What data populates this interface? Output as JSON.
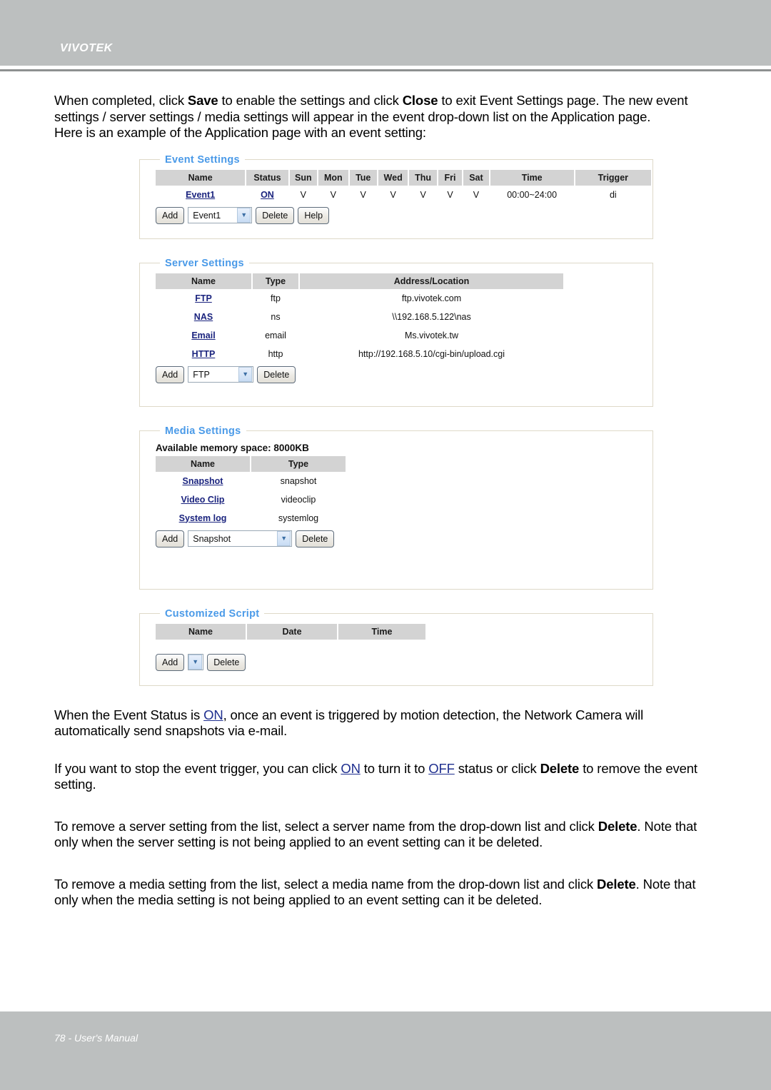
{
  "header": {
    "brand": "VIVOTEK"
  },
  "footer": {
    "text": "78 - User's Manual"
  },
  "intro": {
    "p1_a": "When completed, click ",
    "p1_save": "Save",
    "p1_b": " to enable the settings and click ",
    "p1_close": "Close",
    "p1_c": " to exit Event Settings page. The new event settings / server settings / media settings will appear in the event drop-down list on the Application page.",
    "p2": "Here is an example of the Application page with an event setting:"
  },
  "event_settings": {
    "legend": "Event Settings",
    "columns": [
      "Name",
      "Status",
      "Sun",
      "Mon",
      "Tue",
      "Wed",
      "Thu",
      "Fri",
      "Sat",
      "Time",
      "Trigger"
    ],
    "rows": [
      {
        "name": "Event1",
        "status": "ON",
        "sun": "V",
        "mon": "V",
        "tue": "V",
        "wed": "V",
        "thu": "V",
        "fri": "V",
        "sat": "V",
        "time": "00:00~24:00",
        "trigger": "di"
      }
    ],
    "controls": {
      "add_label": "Add",
      "select_value": "Event1",
      "delete_label": "Delete",
      "help_label": "Help",
      "arrow_icon": "chevron-down-icon"
    }
  },
  "server_settings": {
    "legend": "Server Settings",
    "columns": [
      "Name",
      "Type",
      "Address/Location"
    ],
    "rows": [
      {
        "name": "FTP",
        "type": "ftp",
        "address": "ftp.vivotek.com"
      },
      {
        "name": "NAS",
        "type": "ns",
        "address": "\\\\192.168.5.122\\nas"
      },
      {
        "name": "Email",
        "type": "email",
        "address": "Ms.vivotek.tw"
      },
      {
        "name": "HTTP",
        "type": "http",
        "address": "http://192.168.5.10/cgi-bin/upload.cgi"
      }
    ],
    "controls": {
      "add_label": "Add",
      "select_value": "FTP",
      "delete_label": "Delete",
      "arrow_icon": "chevron-down-icon"
    }
  },
  "media_settings": {
    "legend": "Media Settings",
    "memory_line": "Available memory space: 8000KB",
    "columns": [
      "Name",
      "Type"
    ],
    "rows": [
      {
        "name": "Snapshot",
        "type": "snapshot"
      },
      {
        "name": "Video Clip",
        "type": "videoclip"
      },
      {
        "name": "System log",
        "type": "systemlog"
      }
    ],
    "controls": {
      "add_label": "Add",
      "select_value": "Snapshot",
      "delete_label": "Delete",
      "arrow_icon": "chevron-down-icon"
    }
  },
  "customized_script": {
    "legend": "Customized Script",
    "columns": [
      "Name",
      "Date",
      "Time"
    ],
    "rows": [],
    "controls": {
      "add_label": "Add",
      "select_value": "",
      "delete_label": "Delete",
      "arrow_icon": "chevron-down-icon"
    }
  },
  "notes": {
    "n1_a": "When the Event Status is ",
    "n1_on": "ON",
    "n1_b": ", once an event is triggered by motion detection, the Network Camera will automatically send snapshots via e-mail.",
    "n2_a": "If you want to stop the event trigger, you can click ",
    "n2_on": "ON",
    "n2_b": " to turn it to ",
    "n2_off": "OFF",
    "n2_c": " status or click ",
    "n2_delete": "Delete",
    "n2_d": " to remove the event setting.",
    "n3_a": "To remove a server setting from the list, select a server name from the drop-down list and click ",
    "n3_delete": "Delete",
    "n3_b": ". Note that only when the server setting is not being applied to an event setting can it be deleted.",
    "n4_a": "To remove a media setting from the list, select a media name from the drop-down list and click ",
    "n4_delete": "Delete",
    "n4_b": ". Note that only when the media setting is not being applied to an event setting can it be deleted."
  },
  "colors": {
    "header_bar": "#bcbfbf",
    "legend_blue": "#4a9ae8",
    "link_navy": "#1a237e",
    "table_header_gray": "#d3d3d3",
    "panel_border": "#ded9c8"
  }
}
